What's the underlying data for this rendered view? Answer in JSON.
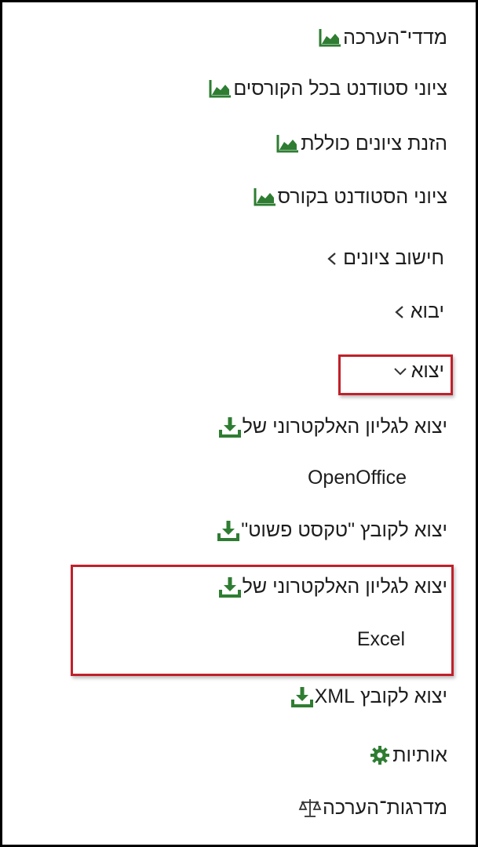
{
  "menu": {
    "report_items": [
      {
        "label": "מדדי־הערכה",
        "icon": "chart-area-icon"
      },
      {
        "label": "ציוני סטודנט בכל הקורסים",
        "icon": "chart-area-icon"
      },
      {
        "label": "הזנת ציונים כוללת",
        "icon": "chart-area-icon"
      },
      {
        "label": "ציוני הסטודנט בקורס",
        "icon": "chart-area-icon"
      }
    ],
    "collapsed_groups": [
      {
        "label": "חישוב ציונים",
        "icon": "chevron-left-icon"
      },
      {
        "label": "יבוא",
        "icon": "chevron-left-icon"
      }
    ],
    "export_group": {
      "label": "יצוא",
      "icon": "chevron-down-icon"
    },
    "export_items": [
      {
        "label_line1": "יצוא לגליון האלקטרוני של",
        "label_line2": "OpenOffice",
        "icon": "download-icon"
      },
      {
        "label_line1": "יצוא לקובץ \"טקסט פשוט\"",
        "icon": "download-icon"
      },
      {
        "label_line1": "יצוא לגליון האלקטרוני של",
        "label_line2": "Excel",
        "icon": "download-icon"
      },
      {
        "label_line1": "יצוא לקובץ XML",
        "icon": "download-icon"
      }
    ],
    "settings_items": [
      {
        "label": "אותיות",
        "icon": "gear-icon"
      },
      {
        "label": "מדרגות־הערכה",
        "icon": "balance-scale-icon"
      }
    ]
  },
  "colors": {
    "icon_green": "#2e7d32",
    "highlight_red": "#c0202a"
  }
}
